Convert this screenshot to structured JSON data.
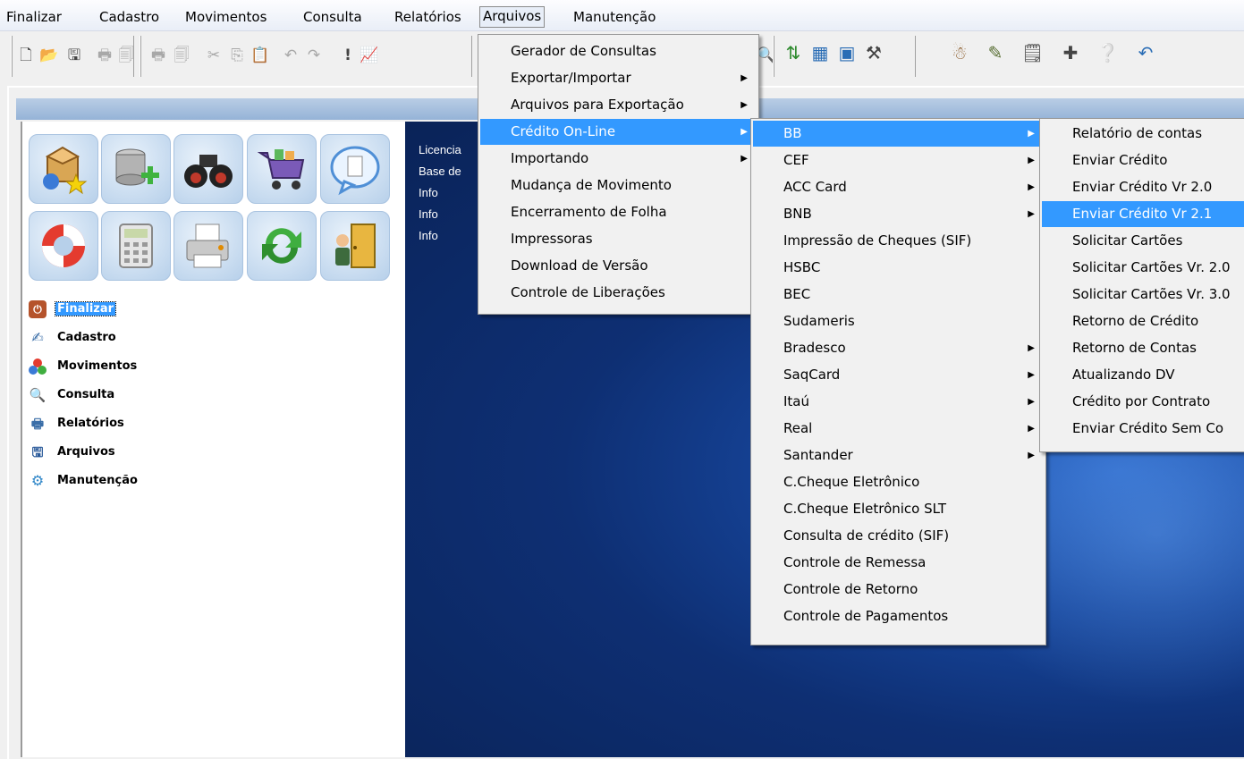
{
  "menubar": {
    "items": [
      "Finalizar",
      "Cadastro",
      "Movimentos",
      "Consulta",
      "Relatórios",
      "Arquivos",
      "Manutenção"
    ],
    "active": "Arquivos"
  },
  "info_lines": [
    "Licencia",
    "Base de",
    "Info",
    "Info",
    "Info"
  ],
  "nav": {
    "items": [
      {
        "label": "Finalizar",
        "icon": "power-icon"
      },
      {
        "label": "Cadastro",
        "icon": "cadastro-icon"
      },
      {
        "label": "Movimentos",
        "icon": "movimentos-icon"
      },
      {
        "label": "Consulta",
        "icon": "magnifier-icon"
      },
      {
        "label": "Relatórios",
        "icon": "printer-icon"
      },
      {
        "label": "Arquivos",
        "icon": "floppy-icon"
      },
      {
        "label": "Manutenção",
        "icon": "gear-icon"
      }
    ],
    "selected": "Finalizar"
  },
  "tiles": [
    "box-star-icon",
    "database-add-icon",
    "binoculars-icon",
    "shopping-cart-icon",
    "speech-bubble-icon",
    "lifebuoy-icon",
    "calculator-icon",
    "printer-icon",
    "refresh-icon",
    "door-exit-icon"
  ],
  "menu_arquivos": [
    {
      "label": "Gerador de Consultas",
      "submenu": false
    },
    {
      "label": "Exportar/Importar",
      "submenu": true
    },
    {
      "label": "Arquivos para Exportação",
      "submenu": true
    },
    {
      "label": "Crédito On-Line",
      "submenu": true
    },
    {
      "label": "Importando",
      "submenu": true
    },
    {
      "label": "Mudança de Movimento",
      "submenu": false
    },
    {
      "label": "Encerramento de Folha",
      "submenu": false
    },
    {
      "label": "Impressoras",
      "submenu": false
    },
    {
      "label": "Download de Versão",
      "submenu": false
    },
    {
      "label": "Controle de Liberações",
      "submenu": false
    }
  ],
  "menu_credito": [
    {
      "label": "BB",
      "submenu": true
    },
    {
      "label": "CEF",
      "submenu": true
    },
    {
      "label": "ACC Card",
      "submenu": true
    },
    {
      "label": "BNB",
      "submenu": true
    },
    {
      "label": "Impressão de Cheques (SIF)",
      "submenu": false
    },
    {
      "label": "HSBC",
      "submenu": false
    },
    {
      "label": "BEC",
      "submenu": false
    },
    {
      "label": "Sudameris",
      "submenu": false
    },
    {
      "label": "Bradesco",
      "submenu": true
    },
    {
      "label": "SaqCard",
      "submenu": true
    },
    {
      "label": "Itaú",
      "submenu": true
    },
    {
      "label": "Real",
      "submenu": true
    },
    {
      "label": "Santander",
      "submenu": true
    },
    {
      "label": "C.Cheque Eletrônico",
      "submenu": false
    },
    {
      "label": "C.Cheque Eletrônico SLT",
      "submenu": false
    },
    {
      "label": "Consulta de crédito (SIF)",
      "submenu": false
    },
    {
      "label": "Controle de Remessa",
      "submenu": false
    },
    {
      "label": "Controle de Retorno",
      "submenu": false
    },
    {
      "label": "Controle de Pagamentos",
      "submenu": false
    }
  ],
  "menu_bb": [
    {
      "label": "Relatório de contas"
    },
    {
      "label": "Enviar Crédito"
    },
    {
      "label": "Enviar Crédito Vr 2.0"
    },
    {
      "label": "Enviar Crédito Vr 2.1"
    },
    {
      "label": "Solicitar Cartões"
    },
    {
      "label": "Solicitar Cartões Vr. 2.0"
    },
    {
      "label": "Solicitar Cartões Vr. 3.0"
    },
    {
      "label": "Retorno de Crédito"
    },
    {
      "label": "Retorno de Contas"
    },
    {
      "label": "Atualizando DV"
    },
    {
      "label": "Crédito por Contrato"
    },
    {
      "label": "Enviar Crédito Sem Co"
    }
  ],
  "highlighted": {
    "arquivos": 3,
    "credito": 0,
    "bb": 3
  },
  "colors": {
    "highlight": "#3399ff",
    "desktop": "#0e2f73",
    "tile": "#b7d0ea"
  }
}
